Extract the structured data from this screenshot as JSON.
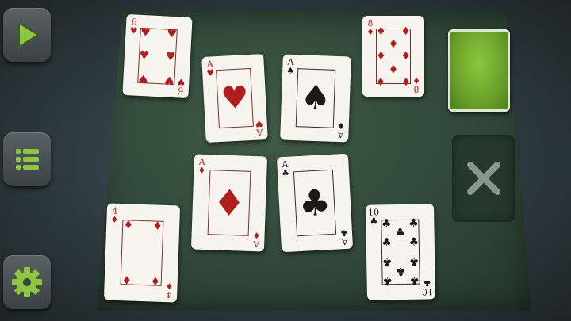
{
  "sidebar": {
    "buttons": [
      {
        "name": "play-button",
        "icon": "play-icon"
      },
      {
        "name": "menu-button",
        "icon": "list-icon"
      },
      {
        "name": "settings-button",
        "icon": "gear-icon"
      }
    ],
    "accent": "#8dc63f"
  },
  "table": {
    "cards": [
      {
        "rank": "6",
        "suit": "hearts",
        "symbol": "♥",
        "color": "red"
      },
      {
        "rank": "A",
        "suit": "hearts",
        "symbol": "♥",
        "color": "red"
      },
      {
        "rank": "A",
        "suit": "spades",
        "symbol": "♠",
        "color": "black"
      },
      {
        "rank": "8",
        "suit": "diamonds",
        "symbol": "♦",
        "color": "red"
      },
      {
        "rank": "A",
        "suit": "diamonds",
        "symbol": "♦",
        "color": "red"
      },
      {
        "rank": "A",
        "suit": "clubs",
        "symbol": "♣",
        "color": "black"
      },
      {
        "rank": "4",
        "suit": "diamonds",
        "symbol": "♦",
        "color": "red"
      },
      {
        "rank": "10",
        "suit": "clubs",
        "symbol": "♣",
        "color": "black"
      }
    ],
    "deck": {
      "icon": "card-back"
    },
    "discard": {
      "icon": "close-icon"
    }
  }
}
